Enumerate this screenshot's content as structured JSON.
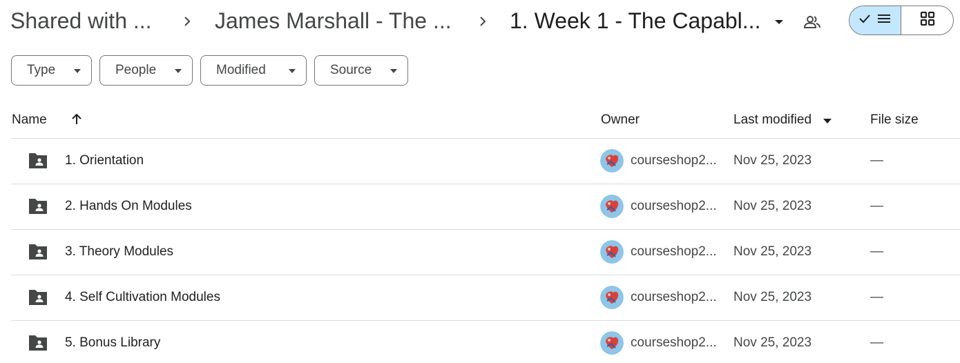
{
  "breadcrumb": {
    "items": [
      {
        "label": "Shared with ..."
      },
      {
        "label": "James Marshall - The ..."
      },
      {
        "label": "1. Week 1 - The Capabl..."
      }
    ]
  },
  "view_toggle": {
    "active": "list",
    "options": [
      "list",
      "grid"
    ]
  },
  "filters": [
    {
      "label": "Type"
    },
    {
      "label": "People"
    },
    {
      "label": "Modified"
    },
    {
      "label": "Source"
    }
  ],
  "columns": {
    "name": "Name",
    "owner": "Owner",
    "last_modified": "Last modified",
    "file_size": "File size"
  },
  "rows": [
    {
      "name": "1. Orientation",
      "owner": "courseshop2...",
      "modified": "Nov 25, 2023",
      "size": "—"
    },
    {
      "name": "2. Hands On Modules",
      "owner": "courseshop2...",
      "modified": "Nov 25, 2023",
      "size": "—"
    },
    {
      "name": "3. Theory Modules",
      "owner": "courseshop2...",
      "modified": "Nov 25, 2023",
      "size": "—"
    },
    {
      "name": "4. Self Cultivation Modules",
      "owner": "courseshop2...",
      "modified": "Nov 25, 2023",
      "size": "—"
    },
    {
      "name": "5. Bonus Library",
      "owner": "courseshop2...",
      "modified": "Nov 25, 2023",
      "size": "—"
    }
  ],
  "icons": {
    "folder": "shared-folder-icon",
    "sort": "arrow-up-icon",
    "avatar": "user-avatar"
  },
  "colors": {
    "toggle_active": "#c2e7ff",
    "folder": "#444746",
    "text": "#1f1f1f",
    "secondary_text": "#444746"
  }
}
